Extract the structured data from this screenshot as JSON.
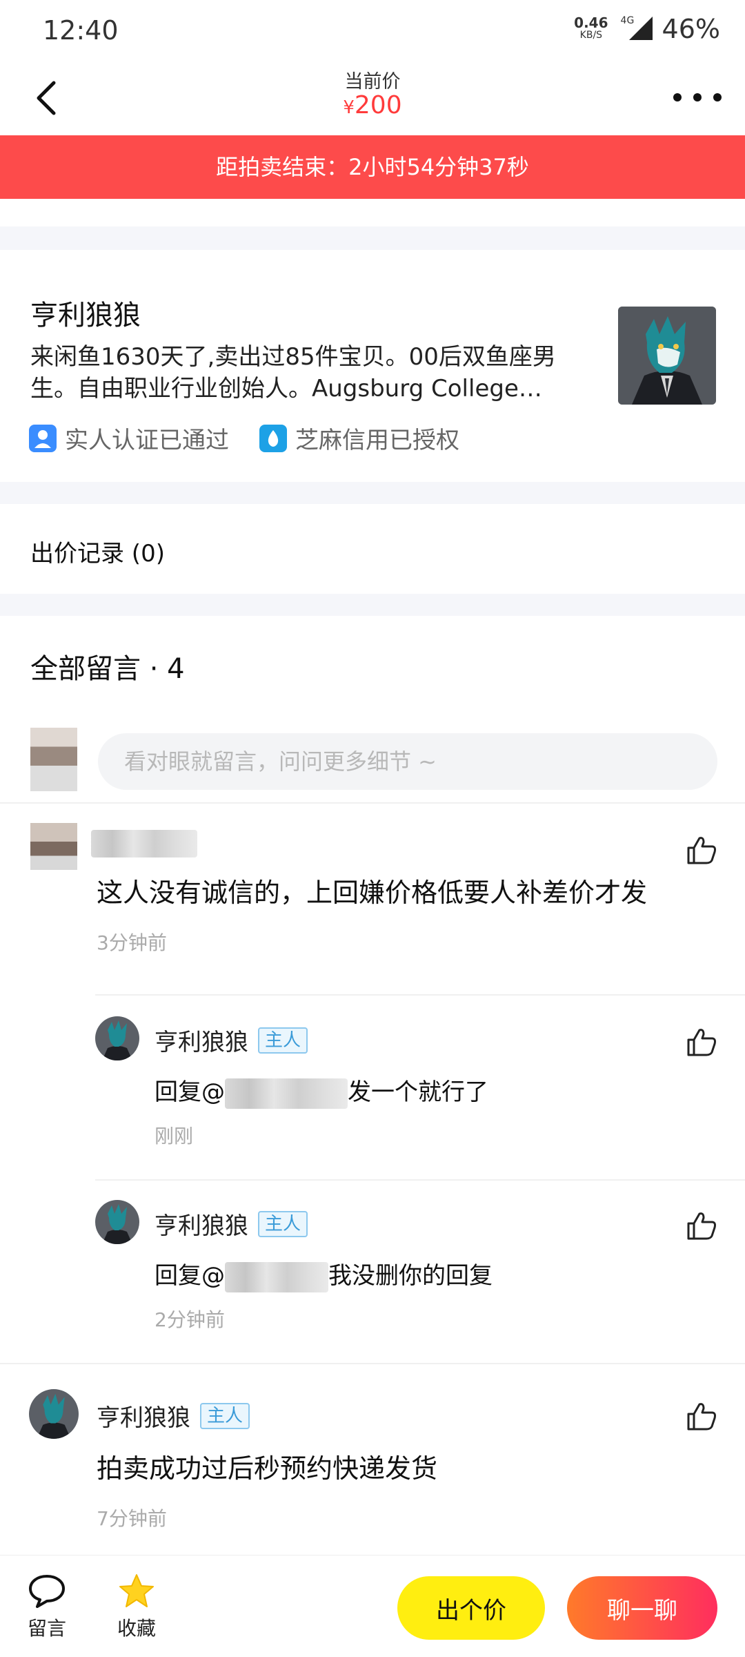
{
  "status_bar": {
    "time": "12:40",
    "net_speed": "0.46",
    "net_unit": "KB/S",
    "network": "4G",
    "battery": "46%"
  },
  "header": {
    "title": "当前价",
    "currency": "¥",
    "price": "200"
  },
  "countdown": {
    "text": "距拍卖结束：2小时54分钟37秒"
  },
  "seller": {
    "name": "亨利狼狼",
    "description": "来闲鱼1630天了,卖出过85件宝贝。00后双鱼座男生。自由职业行业创始人。Augsburg College…",
    "badges": [
      "实人认证已通过",
      "芝麻信用已授权"
    ]
  },
  "bids": {
    "label": "出价记录 (0)"
  },
  "comments": {
    "title": "全部留言 · 4",
    "input_placeholder": "看对眼就留言，问问更多细节 ~",
    "owner_tag": "主人",
    "items": [
      {
        "text": "这人没有诚信的，上回嫌价格低要人补差价才发",
        "time": "3分钟前"
      },
      {
        "name": "亨利狼狼",
        "prefix": "回复@",
        "text": "发一个就行了",
        "time": "刚刚"
      },
      {
        "name": "亨利狼狼",
        "prefix": "回复@",
        "text": "我没删你的回复",
        "time": "2分钟前"
      },
      {
        "name": "亨利狼狼",
        "text": "拍卖成功过后秒预约快递发货",
        "time": "7分钟前"
      }
    ]
  },
  "bottom_bar": {
    "comment_label": "留言",
    "favorite_label": "收藏",
    "bid_button": "出个价",
    "chat_button": "聊一聊"
  },
  "colors": {
    "accent_red": "#fd4b4b",
    "bid_yellow": "#ffee10",
    "chat_gradient": "#ff7a2a-#ff2e5e"
  }
}
